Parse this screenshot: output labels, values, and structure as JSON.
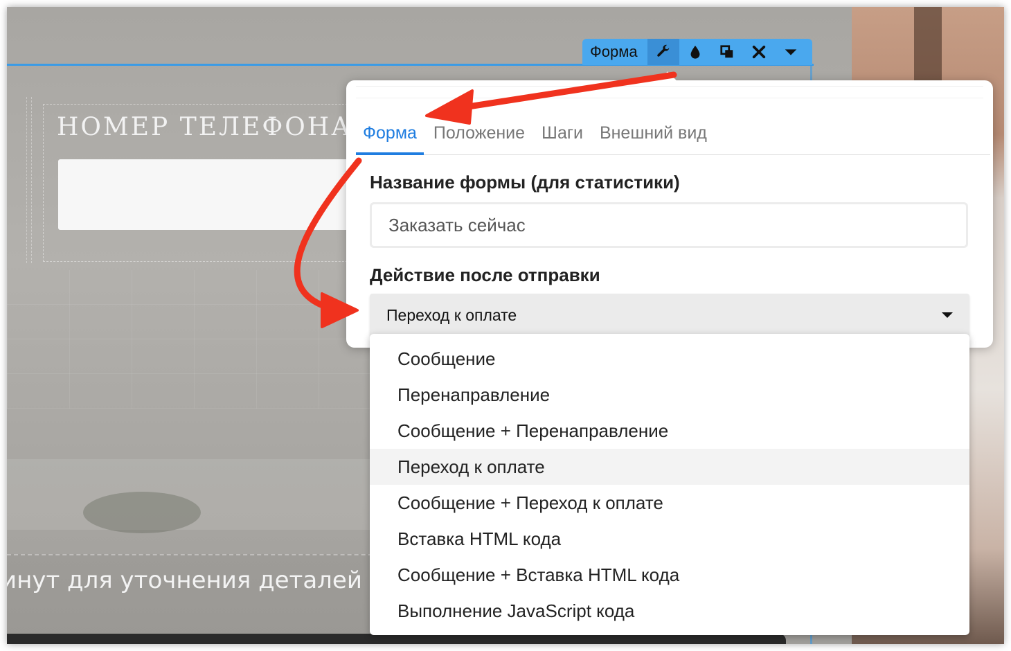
{
  "background": {
    "phone_label": "НОМЕР ТЕЛЕФОНА *",
    "bottom_text": "инут для уточнения деталей по"
  },
  "toolbar": {
    "title": "Форма",
    "buttons": [
      {
        "icon": "wrench-icon",
        "active": true
      },
      {
        "icon": "drop-icon",
        "active": false
      },
      {
        "icon": "duplicate-icon",
        "active": false
      },
      {
        "icon": "close-icon",
        "active": false
      },
      {
        "icon": "chevron-down-icon",
        "active": false
      }
    ]
  },
  "popup": {
    "tabs": [
      {
        "label": "Форма",
        "active": true
      },
      {
        "label": "Положение",
        "active": false
      },
      {
        "label": "Шаги",
        "active": false
      },
      {
        "label": "Внешний вид",
        "active": false
      }
    ],
    "form_name_label": "Название формы (для статистики)",
    "form_name_value": "Заказать сейчас",
    "action_label": "Действие после отправки",
    "action_value": "Переход к оплате"
  },
  "dropdown": {
    "options": [
      "Сообщение",
      "Перенаправление",
      "Сообщение + Перенаправление",
      "Переход к оплате",
      "Сообщение + Переход к оплате",
      "Вставка HTML кода",
      "Сообщение + Вставка HTML кода",
      "Выполнение JavaScript кода"
    ],
    "selected_index": 3
  },
  "colors": {
    "accent": "#1f7de0",
    "toolbar": "#4aa8ee",
    "annotation_arrow": "#f0321e"
  }
}
